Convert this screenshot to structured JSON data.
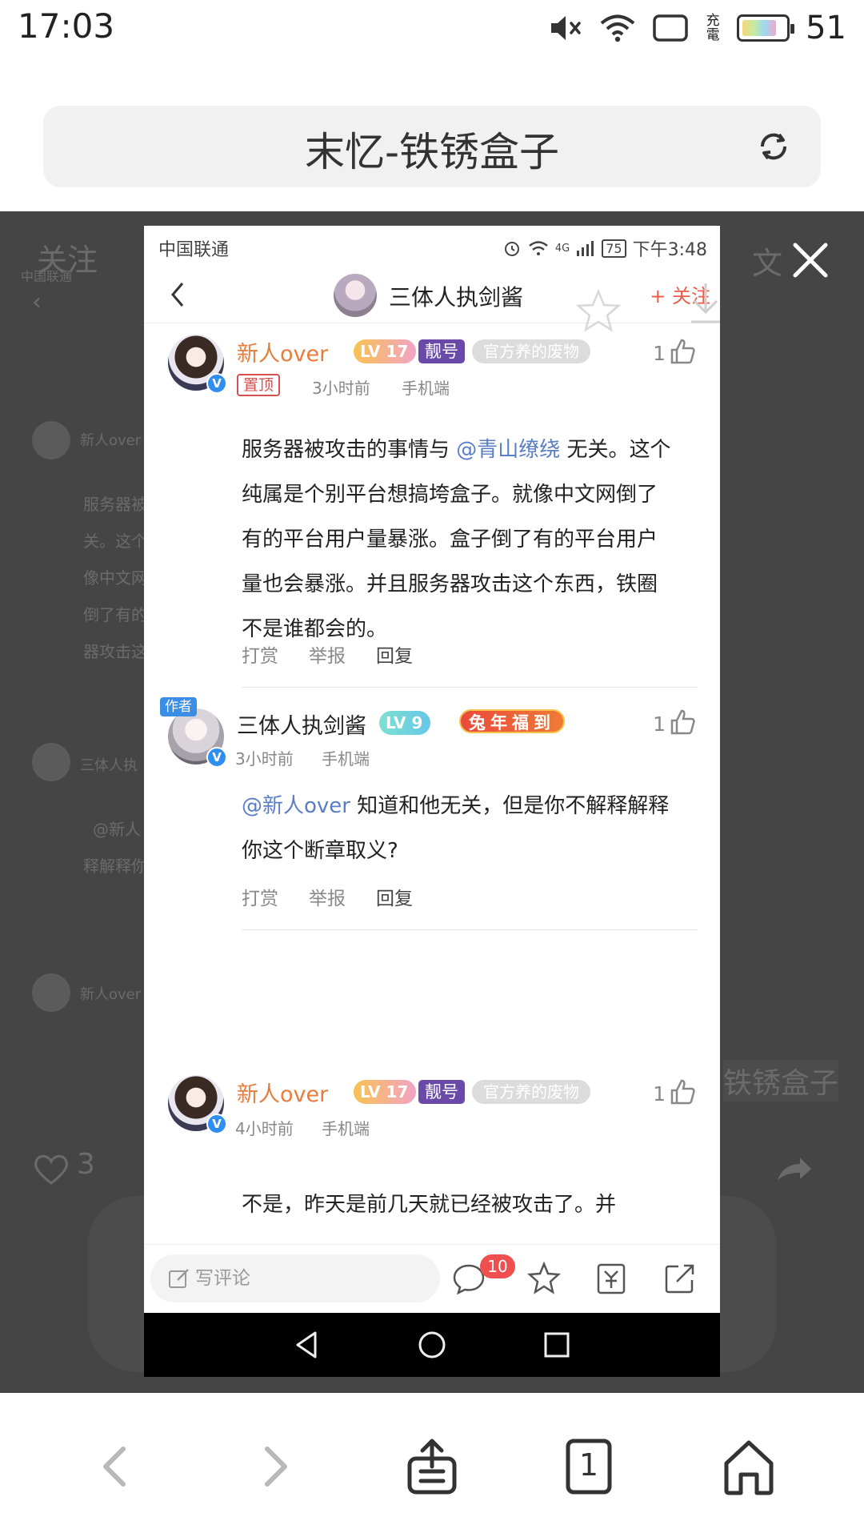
{
  "status_bar": {
    "time": "17:03",
    "charging": "充電",
    "battery": "51"
  },
  "address_bar": {
    "title": "末忆-铁锈盒子"
  },
  "background_page": {
    "tab_follow": "关注",
    "tab_text": "文",
    "snippet_title": "铁锈盒子",
    "likes_count": "3",
    "ghost_carrier": "中国联通",
    "ghost_name1": "新人over",
    "ghost_name2": "三体人执",
    "ghost_line1": "服务器被",
    "ghost_line2": "关。这个",
    "ghost_line3": "像中文网",
    "ghost_line4": "倒了有的",
    "ghost_line5": "器攻击这",
    "ghost_reply": "@新人",
    "ghost_reply2": "释解释你"
  },
  "screenshot": {
    "status": {
      "carrier": "中国联通",
      "time": "下午3:48",
      "battery": "75",
      "network": "4G"
    },
    "header": {
      "name": "三体人执剑酱",
      "follow": "+ 关注"
    },
    "comments": [
      {
        "name": "新人over",
        "level": "17",
        "tag1": "靓号",
        "tag2": "官方养的废物",
        "pin": "置顶",
        "time": "3小时前",
        "device": "手机端",
        "likes": "1",
        "text_before": "服务器被攻击的事情与 ",
        "mention": "@青山缭绕",
        "text_after": " 无关。这个纯属是个别平台想搞垮盒子。就像中文网倒了有的平台用户量暴涨。盒子倒了有的平台用户量也会暴涨。并且服务器攻击这个东西，铁圈不是谁都会的。",
        "actions": [
          "打赏",
          "举报",
          "回复"
        ]
      },
      {
        "author_tag": "作者",
        "name": "三体人执剑酱",
        "level": "9",
        "tag_festive": "兔年福到",
        "time": "3小时前",
        "device": "手机端",
        "likes": "1",
        "mention": "@新人over",
        "text_after": " 知道和他无关，但是你不解释解释你这个断章取义?",
        "actions": [
          "打赏",
          "举报",
          "回复"
        ]
      },
      {
        "name": "新人over",
        "level": "17",
        "tag1": "靓号",
        "tag2": "官方养的废物",
        "time": "4小时前",
        "device": "手机端",
        "likes": "1",
        "text_partial": "不是，昨天是前几天就已经被攻击了。并"
      }
    ],
    "comment_bar": {
      "placeholder": "写评论",
      "count": "10"
    }
  },
  "toolbar": {
    "tabs_count": "1"
  },
  "colors": {
    "accent_orange": "#e87c3c",
    "mention_blue": "#5a7ec6",
    "follow_red": "#ef5a4a",
    "badge_red": "#ef4f4f"
  }
}
